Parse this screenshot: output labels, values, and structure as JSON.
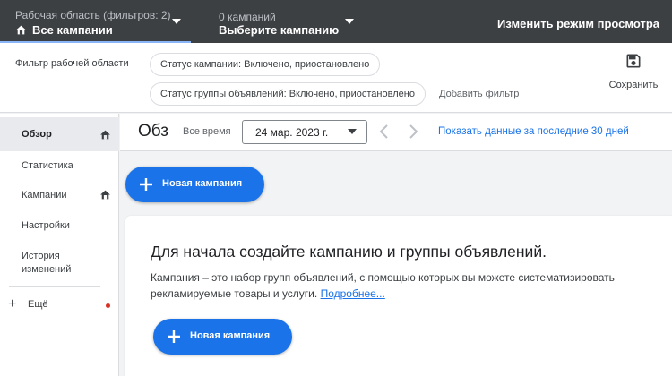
{
  "topbar": {
    "workspace_sub": "Рабочая область (фильтров: 2)",
    "workspace_main": "Все кампании",
    "campaign_sub": "0 кампаний",
    "campaign_main": "Выберите кампанию",
    "view_mode": "Изменить режим просмотра"
  },
  "filterbar": {
    "label": "Фильтр рабочей области",
    "chips": [
      "Статус кампании: Включено, приостановлено",
      "Статус группы объявлений: Включено, приостановлено"
    ],
    "add_filter": "Добавить фильтр",
    "save_label": "Сохранить"
  },
  "sidebar": {
    "items": [
      {
        "label": "Обзор",
        "icon": "home-icon",
        "active": true
      },
      {
        "label": "Статистика"
      },
      {
        "label": "Кампании",
        "icon": "home-icon"
      },
      {
        "label": "Настройки"
      },
      {
        "label": "История изменений"
      }
    ],
    "more_label": "Ещё"
  },
  "header": {
    "title": "Обз",
    "time_label": "Все время",
    "date_value": "24 мар. 2023 г.",
    "last30": "Показать данные за последние 30 дней"
  },
  "main": {
    "new_campaign_label": "Новая кампания",
    "card": {
      "title": "Для начала создайте кампанию и группы объявлений.",
      "description": "Кампания – это набор групп объявлений, с помощью которых вы можете систематизировать рекламируемые товары и услуги.",
      "link": "Подробнее...",
      "button_label": "Новая кампания"
    }
  },
  "colors": {
    "topbar_bg": "#3c4043",
    "accent": "#1a73e8",
    "notification_dot": "#d93025"
  }
}
